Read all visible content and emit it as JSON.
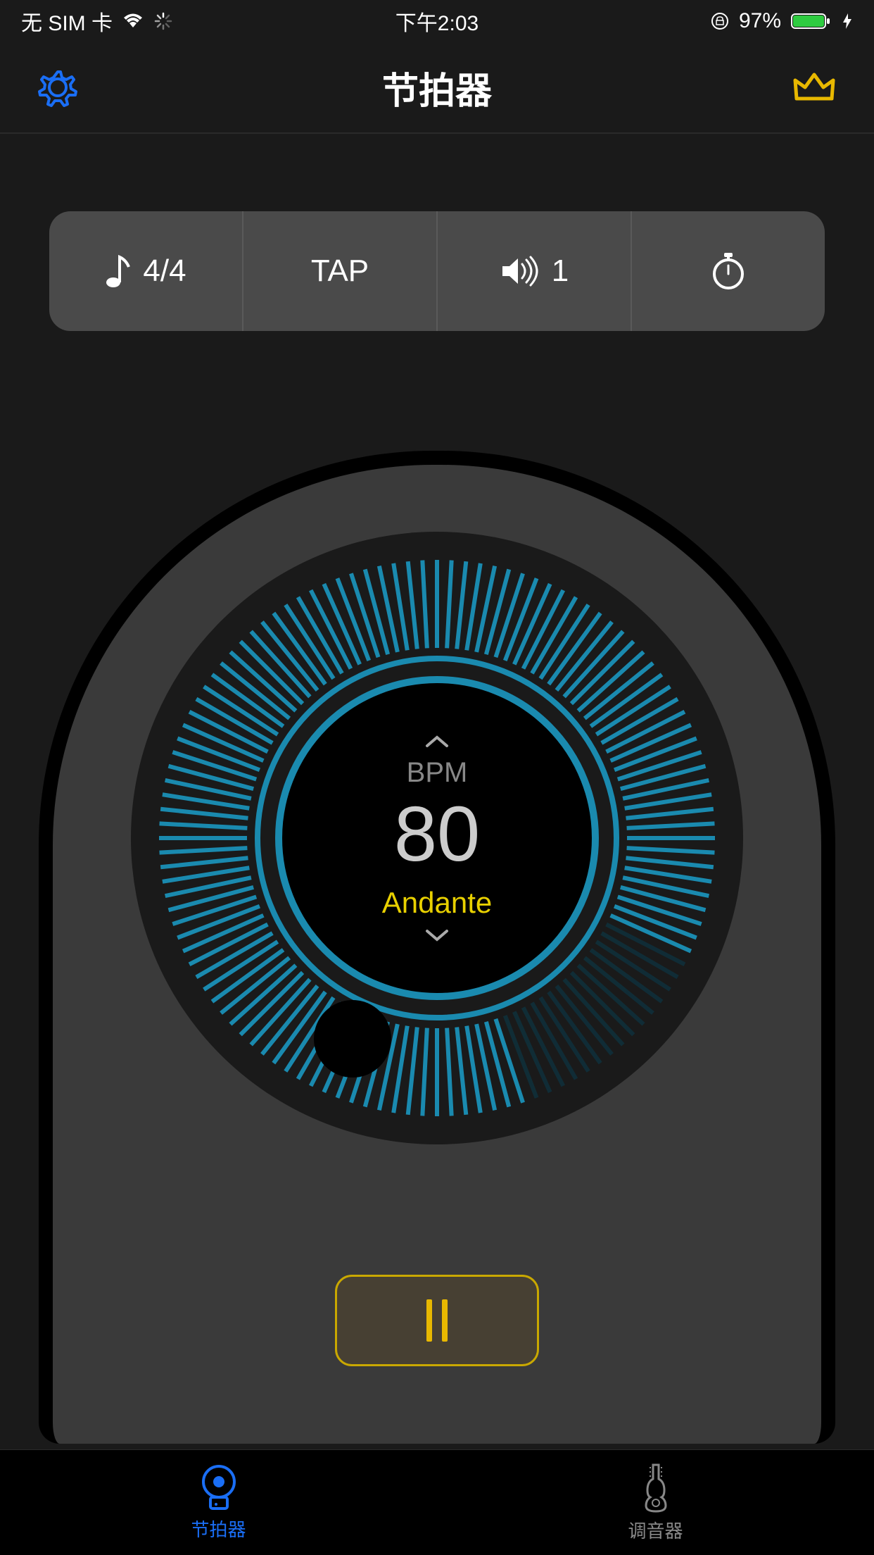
{
  "status": {
    "sim": "无 SIM 卡",
    "time": "下午2:03",
    "battery": "97%"
  },
  "header": {
    "title": "节拍器"
  },
  "controls": {
    "time_signature": "4/4",
    "tap_label": "TAP",
    "sound_level": "1"
  },
  "dial": {
    "bpm_label": "BPM",
    "bpm_value": "80",
    "tempo_name": "Andante"
  },
  "tabs": {
    "metronome": "节拍器",
    "tuner": "调音器"
  },
  "colors": {
    "accent_blue": "#1a6ef5",
    "dial_teal": "#1a8aaf",
    "gold": "#e8b800"
  }
}
